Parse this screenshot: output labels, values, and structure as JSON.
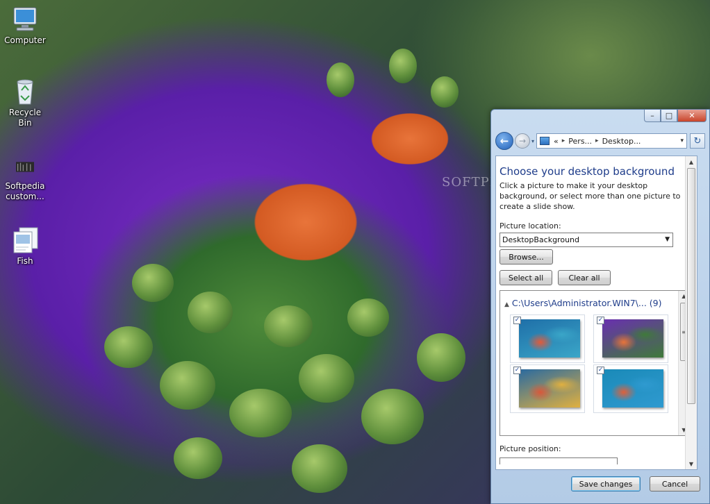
{
  "desktop": {
    "icons": [
      {
        "label": "Computer"
      },
      {
        "label": "Recycle Bin"
      },
      {
        "label": "Softpedia custom..."
      },
      {
        "label": "Fish"
      }
    ],
    "watermark": "SOFTPEDIA"
  },
  "window": {
    "controls": {
      "minimize": "–",
      "maximize": "□",
      "close": "✕"
    },
    "nav": {
      "back": "←",
      "forward": "→",
      "history": "▾"
    },
    "address": {
      "prefix": "«",
      "crumbs": [
        "Pers...",
        "Desktop..."
      ],
      "separator": "▸",
      "dropdown": "▾"
    },
    "refresh": "↻",
    "heading": "Choose your desktop background",
    "description": "Click a picture to make it your desktop background, or select more than one picture to create a slide show.",
    "picture_location": {
      "label": "Picture location:",
      "value": "DesktopBackground",
      "caret": "▼"
    },
    "browse_label": "Browse...",
    "select_all_label": "Select all",
    "clear_all_label": "Clear all",
    "gallery": {
      "group_toggle": "▲",
      "group_title": "C:\\Users\\Administrator.WIN7\\... (9)",
      "checkmark": "✓",
      "scroll_up": "▲",
      "scroll_down": "▼",
      "scroll_grip": "≡",
      "thumbnails": [
        {
          "checked": true,
          "colors": [
            "#1f6fa8",
            "#e25a3a",
            "#3aa6c8"
          ]
        },
        {
          "checked": true,
          "colors": [
            "#6a2fb0",
            "#e8743a",
            "#3f7a3a"
          ]
        },
        {
          "checked": true,
          "colors": [
            "#2a6aa0",
            "#d9583a",
            "#e0b040"
          ]
        },
        {
          "checked": true,
          "colors": [
            "#1a8ab8",
            "#e0603a",
            "#2f9ad0"
          ]
        }
      ]
    },
    "picture_position": {
      "label": "Picture position:"
    },
    "save_label": "Save changes",
    "cancel_label": "Cancel",
    "scroll_up": "▲",
    "scroll_down": "▼"
  }
}
